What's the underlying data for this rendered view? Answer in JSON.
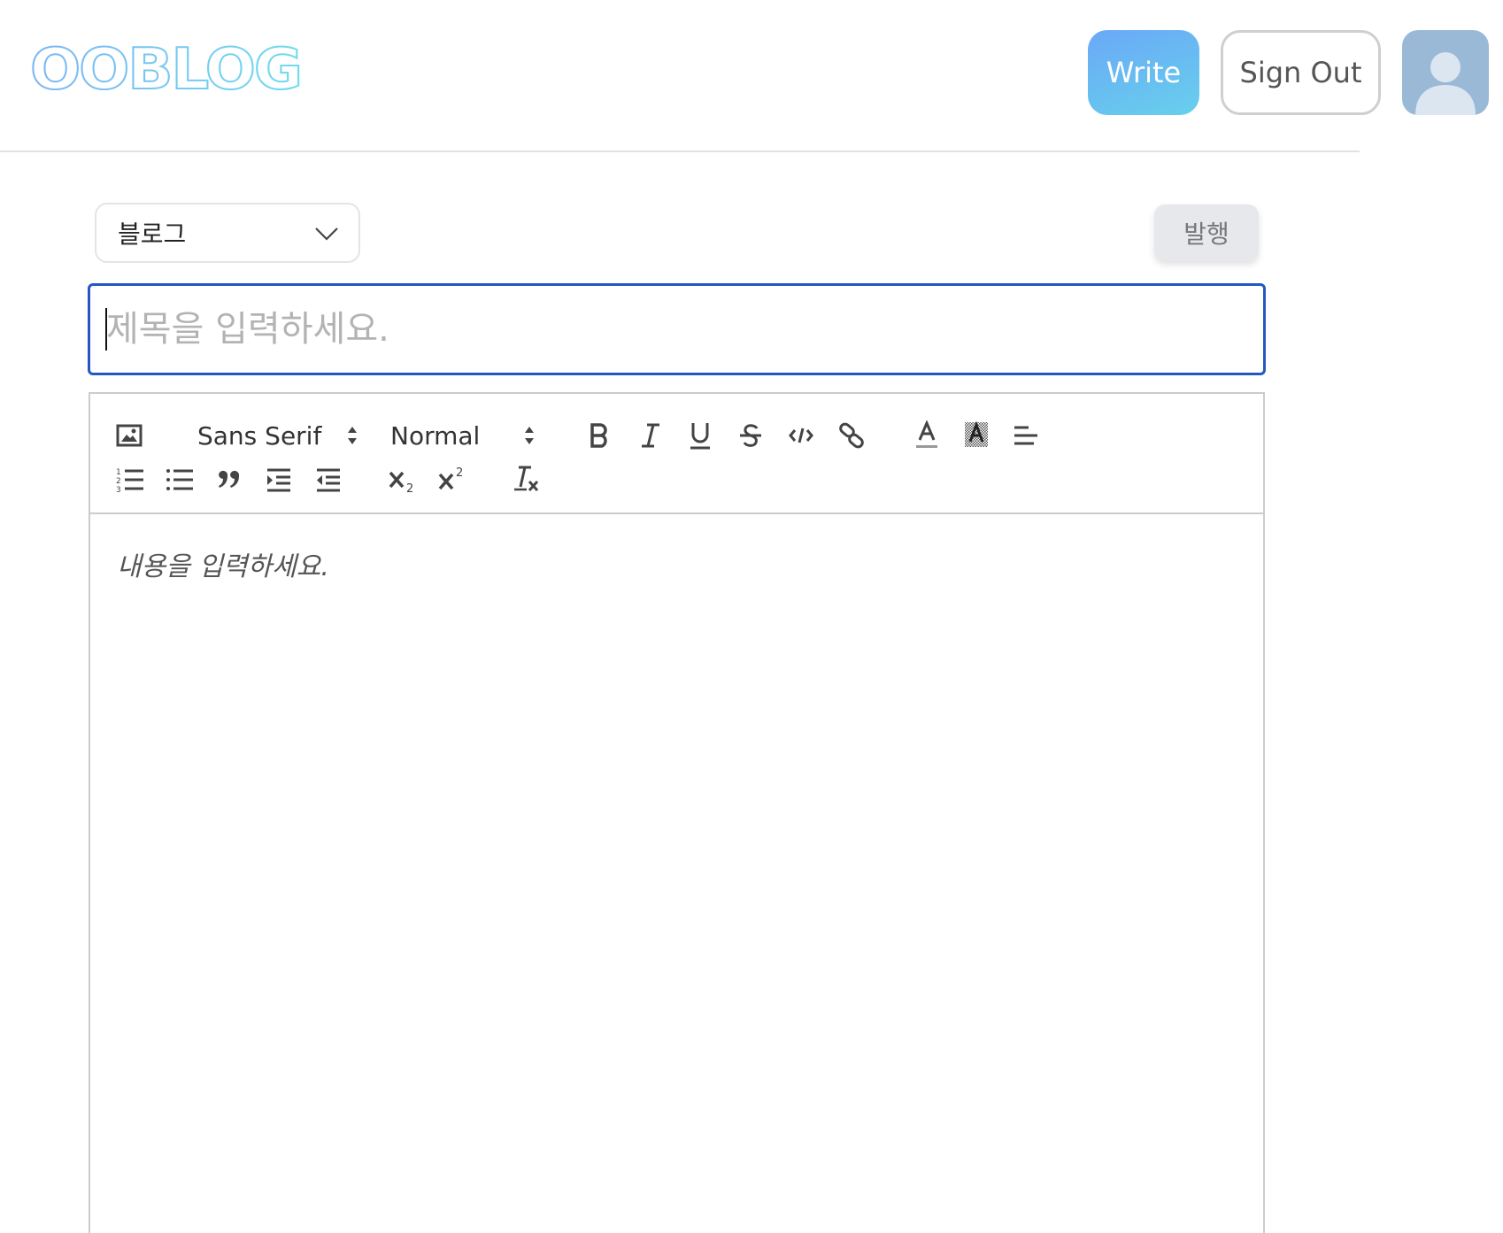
{
  "header": {
    "logo_text": "OOBLOG",
    "write_label": "Write",
    "signout_label": "Sign Out",
    "avatar_icon": "user-avatar-icon"
  },
  "post": {
    "category_selected": "블로그",
    "publish_label": "발행",
    "title_placeholder": "제목을 입력하세요.",
    "title_value": ""
  },
  "editor": {
    "font_picker": "Sans Serif",
    "size_picker": "Normal",
    "content_placeholder": "내용을 입력하세요.",
    "toolbar_icons": [
      "image-icon",
      "bold-icon",
      "italic-icon",
      "underline-icon",
      "strike-icon",
      "code-icon",
      "link-icon",
      "text-color-icon",
      "background-color-icon",
      "align-icon",
      "ordered-list-icon",
      "bullet-list-icon",
      "blockquote-icon",
      "indent-icon",
      "outdent-icon",
      "subscript-icon",
      "superscript-icon",
      "clean-format-icon"
    ]
  },
  "colors": {
    "accent": "#2557c2",
    "write_gradient_start": "#6aa8f7",
    "write_gradient_end": "#67d0ec",
    "avatar_bg": "#9ab9d6"
  }
}
